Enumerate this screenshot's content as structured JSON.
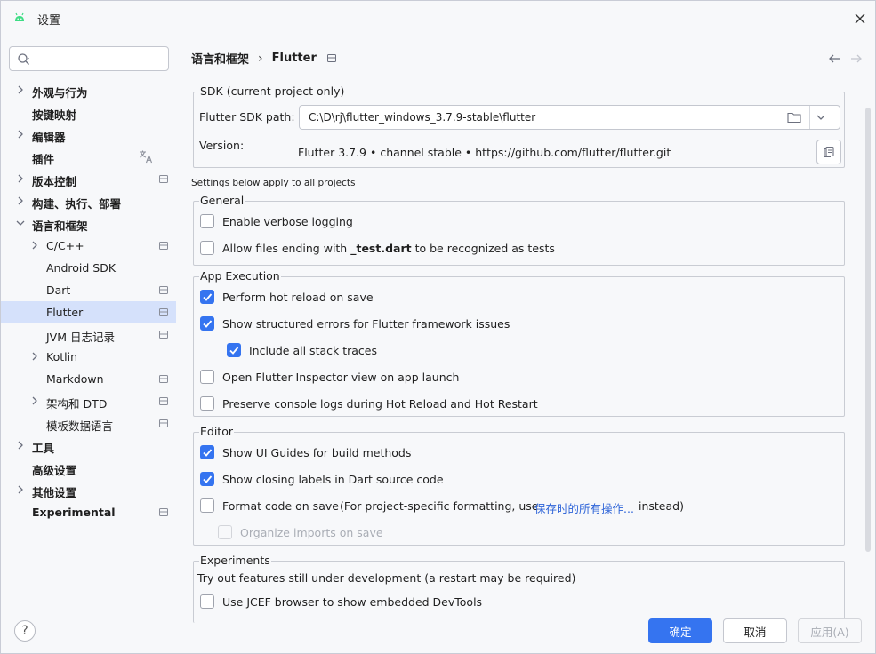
{
  "window": {
    "title": "设置",
    "close_icon": "close-icon",
    "app_icon": "android-icon"
  },
  "sidebar": {
    "search_placeholder": "",
    "items": [
      {
        "label": "外观与行为",
        "expandable": true,
        "bold": true,
        "level": 0
      },
      {
        "label": "按键映射",
        "expandable": false,
        "bold": true,
        "level": 0
      },
      {
        "label": "编辑器",
        "expandable": true,
        "bold": true,
        "level": 0
      },
      {
        "label": "插件",
        "expandable": false,
        "bold": true,
        "level": 0,
        "icon": "translate-icon"
      },
      {
        "label": "版本控制",
        "expandable": true,
        "bold": true,
        "level": 0,
        "icon": "project-scope-icon"
      },
      {
        "label": "构建、执行、部署",
        "expandable": true,
        "bold": true,
        "level": 0
      },
      {
        "label": "语言和框架",
        "expandable": true,
        "expanded": true,
        "bold": true,
        "level": 0
      },
      {
        "label": "C/C++",
        "expandable": true,
        "bold": false,
        "level": 1,
        "icon": "project-scope-icon"
      },
      {
        "label": "Android SDK",
        "expandable": false,
        "bold": false,
        "level": 1
      },
      {
        "label": "Dart",
        "expandable": false,
        "bold": false,
        "level": 1,
        "icon": "project-scope-icon"
      },
      {
        "label": "Flutter",
        "expandable": false,
        "bold": false,
        "level": 1,
        "icon": "project-scope-icon",
        "selected": true
      },
      {
        "label": "JVM 日志记录",
        "expandable": false,
        "bold": false,
        "level": 1,
        "icon": "project-scope-icon"
      },
      {
        "label": "Kotlin",
        "expandable": true,
        "bold": false,
        "level": 1
      },
      {
        "label": "Markdown",
        "expandable": false,
        "bold": false,
        "level": 1,
        "icon": "project-scope-icon"
      },
      {
        "label": "架构和 DTD",
        "expandable": true,
        "bold": false,
        "level": 1,
        "icon": "project-scope-icon"
      },
      {
        "label": "模板数据语言",
        "expandable": false,
        "bold": false,
        "level": 1,
        "icon": "project-scope-icon"
      },
      {
        "label": "工具",
        "expandable": true,
        "bold": true,
        "level": 0
      },
      {
        "label": "高级设置",
        "expandable": false,
        "bold": true,
        "level": 0
      },
      {
        "label": "其他设置",
        "expandable": true,
        "bold": true,
        "level": 0
      },
      {
        "label": "Experimental",
        "expandable": false,
        "bold": true,
        "level": 0,
        "icon": "project-scope-icon"
      }
    ]
  },
  "breadcrumb": {
    "parent": "语言和框架",
    "separator": "›",
    "current": "Flutter"
  },
  "sdk": {
    "group_title": "SDK (current project only)",
    "path_label": "Flutter SDK path:",
    "path_value": "C:\\D\\rj\\flutter_windows_3.7.9-stable\\flutter",
    "version_label": "Version:",
    "version_value": "Flutter 3.7.9 • channel stable • https://github.com/flutter/flutter.git"
  },
  "note": "Settings below apply to all projects",
  "general": {
    "title": "General",
    "options": [
      {
        "label": "Enable verbose logging",
        "checked": false
      },
      {
        "label_pre": "Allow files ending with ",
        "label_bold": "_test.dart",
        "label_post": " to be recognized as tests",
        "checked": false
      }
    ]
  },
  "app_execution": {
    "title": "App Execution",
    "options": [
      {
        "label": "Perform hot reload on save",
        "checked": true
      },
      {
        "label": "Show structured errors for Flutter framework issues",
        "checked": true
      },
      {
        "label": "Include all stack traces",
        "checked": true
      },
      {
        "label": "Open Flutter Inspector view on app launch",
        "checked": false
      },
      {
        "label": "Preserve console logs during Hot Reload and Hot Restart",
        "checked": false
      }
    ]
  },
  "editor": {
    "title": "Editor",
    "options": [
      {
        "label": "Show UI Guides for build methods",
        "checked": true
      },
      {
        "label": "Show closing labels in Dart source code",
        "checked": true
      },
      {
        "label": "Format code on save",
        "checked": false,
        "hint_pre": "(For project-specific formatting, use",
        "hint_link": "保存时的所有操作...",
        "hint_post": "instead)"
      },
      {
        "label": "Organize imports on save",
        "checked": false,
        "disabled": true
      }
    ]
  },
  "experiments": {
    "title": "Experiments",
    "description": "Try out features still under development (a restart may be required)",
    "options": [
      {
        "label": "Use JCEF browser to show embedded DevTools",
        "checked": false
      }
    ]
  },
  "footer": {
    "help": "?",
    "ok": "确定",
    "cancel": "取消",
    "apply": "应用(A)"
  },
  "colors": {
    "accent": "#3574f0",
    "selection": "#d5e1fb",
    "link": "#2e64d8",
    "background": "#f7f8fa"
  }
}
